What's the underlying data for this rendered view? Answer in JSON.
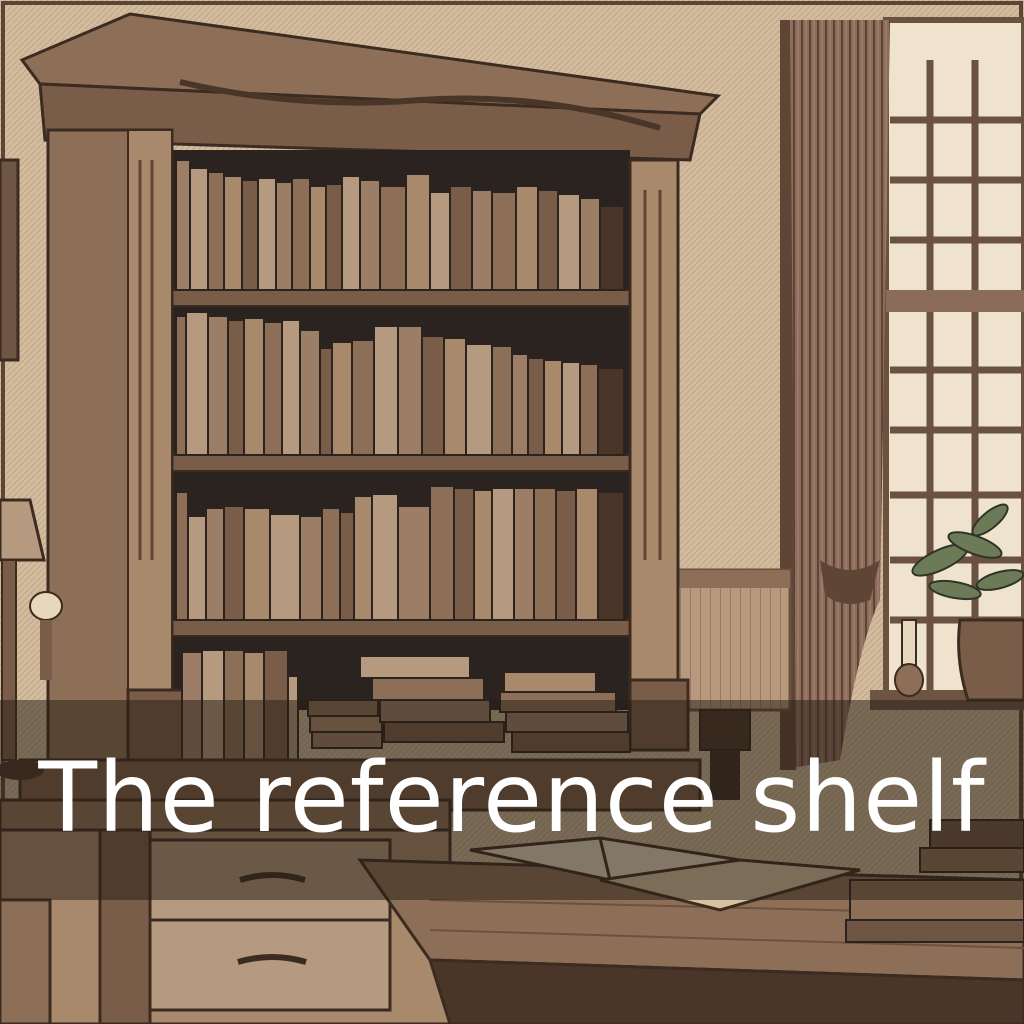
{
  "caption": {
    "text": "The reference shelf"
  },
  "palette": {
    "paper": "#efe3cd",
    "wood_light": "#a8896c",
    "wood_mid": "#7a5d48",
    "wood_dark": "#4a3628",
    "shadow": "#2a2320",
    "caption_text": "#ffffff"
  },
  "scene": {
    "description_icons": [
      "bookcase-icon",
      "window-icon",
      "curtain-icon",
      "plant-icon",
      "desk-icon",
      "open-book-icon",
      "candle-icon"
    ]
  }
}
